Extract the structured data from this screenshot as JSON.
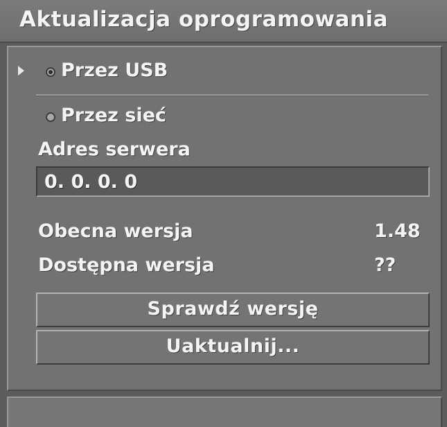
{
  "window": {
    "title": "Aktualizacja oprogramowania"
  },
  "options": [
    {
      "label": "Przez USB",
      "selected": true
    },
    {
      "label": "Przez sieć",
      "selected": false
    }
  ],
  "server": {
    "label": "Adres serwera",
    "value": "0. 0. 0. 0"
  },
  "versions": {
    "current_label": "Obecna wersja",
    "current_value": "1.48",
    "available_label": "Dostępna wersja",
    "available_value": "??"
  },
  "buttons": {
    "check_label": "Sprawdź wersję",
    "update_label": "Uaktualnij..."
  }
}
